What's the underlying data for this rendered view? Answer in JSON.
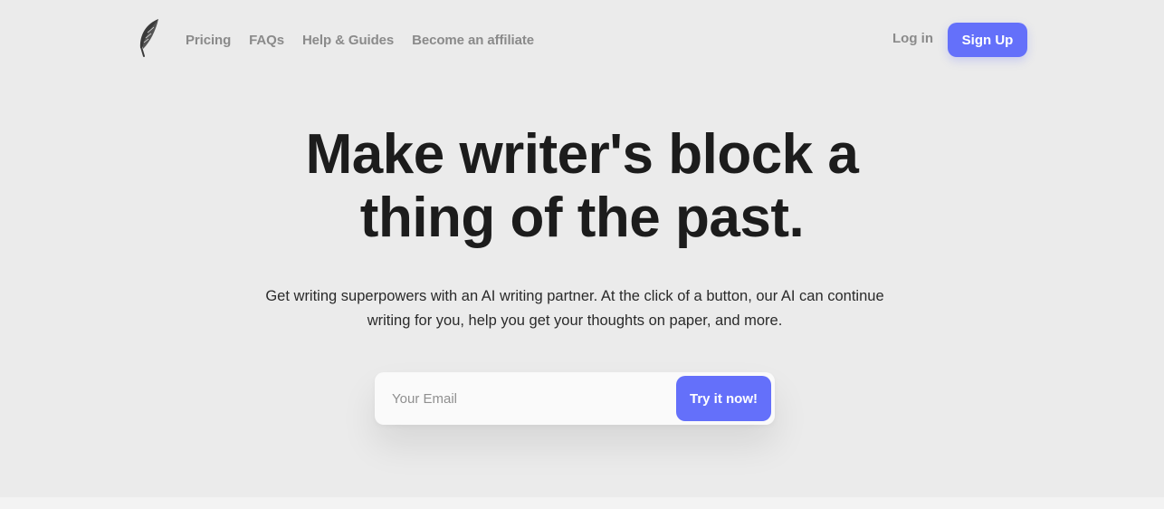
{
  "nav": {
    "logo_icon": "feather-quill-icon",
    "links": [
      {
        "label": "Pricing"
      },
      {
        "label": "FAQs"
      },
      {
        "label": "Help & Guides"
      },
      {
        "label": "Become an affiliate"
      }
    ],
    "login_label": "Log in",
    "signup_label": "Sign Up"
  },
  "hero": {
    "headline_line1": "Make writer's block a",
    "headline_line2": "thing of the past.",
    "subtext_line1": "Get writing superpowers with an AI writing partner. At the click of a button, our AI can continue",
    "subtext_line2": "writing for you, help you get your thoughts on paper, and more."
  },
  "signup_form": {
    "email_placeholder": "Your Email",
    "email_value": "",
    "submit_label": "Try it now!"
  },
  "colors": {
    "background": "#ebebeb",
    "accent": "#6470fa",
    "nav_text": "#8a8a8a",
    "headline_text": "#1c1c1c"
  }
}
